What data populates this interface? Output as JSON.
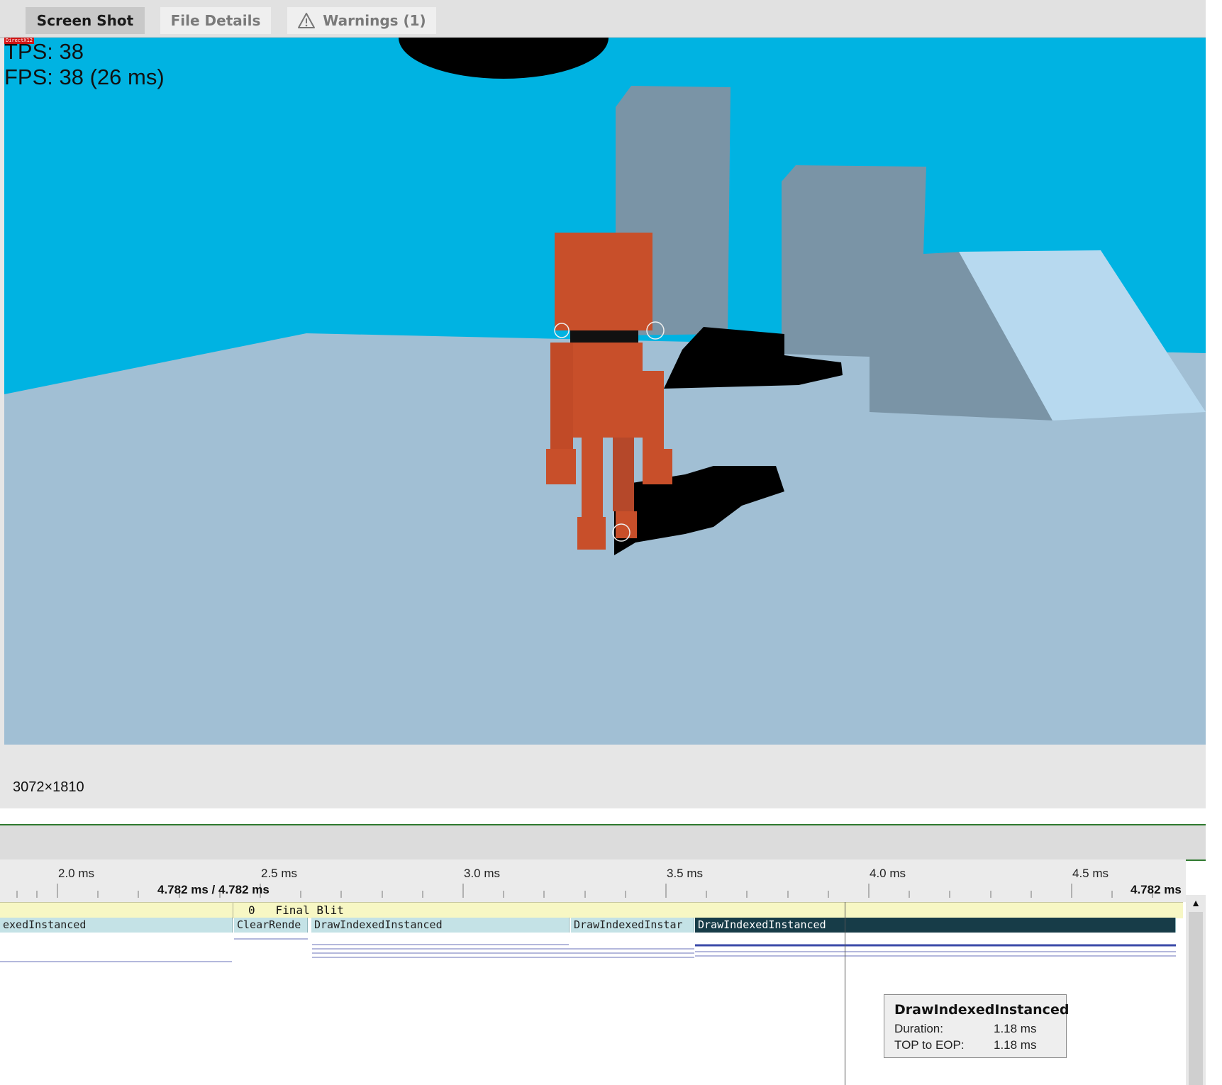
{
  "tabs": [
    {
      "label": "Screen Shot",
      "active": true
    },
    {
      "label": "File Details",
      "active": false
    },
    {
      "label": "Warnings (1)",
      "active": false,
      "icon": "warning-triangle-icon"
    }
  ],
  "screenshot": {
    "api_badge": "DirectX12",
    "tps_text": "TPS: 38",
    "fps_text": "FPS: 38 (26 ms)",
    "resolution": "3072×1810",
    "colors": {
      "sky": "#00b3e2",
      "ground": "#a1bfd4",
      "pillar": "#7a94a6",
      "character": "#c84f2a",
      "shadow": "#000000"
    }
  },
  "timeline": {
    "ticks": [
      "2.0 ms",
      "2.5 ms",
      "3.0 ms",
      "3.5 ms",
      "4.0 ms",
      "4.5 ms"
    ],
    "cursor_time": "4.782 ms / 4.782 ms",
    "end_time": "4.782 ms",
    "marker": {
      "index": "0",
      "label": "Final Blit",
      "text": "0   Final Blit"
    },
    "events": [
      {
        "label": "exedInstanced"
      },
      {
        "label": "ClearRende"
      },
      {
        "label": "DrawIndexedInstanced"
      },
      {
        "label": "DrawIndexedInstar"
      },
      {
        "label": "DrawIndexedInstanced",
        "selected": true
      }
    ]
  },
  "tooltip": {
    "title": "DrawIndexedInstanced",
    "rows": [
      {
        "key": "Duration:",
        "value": "1.18 ms"
      },
      {
        "key": "TOP to EOP:",
        "value": "1.18 ms"
      }
    ]
  }
}
